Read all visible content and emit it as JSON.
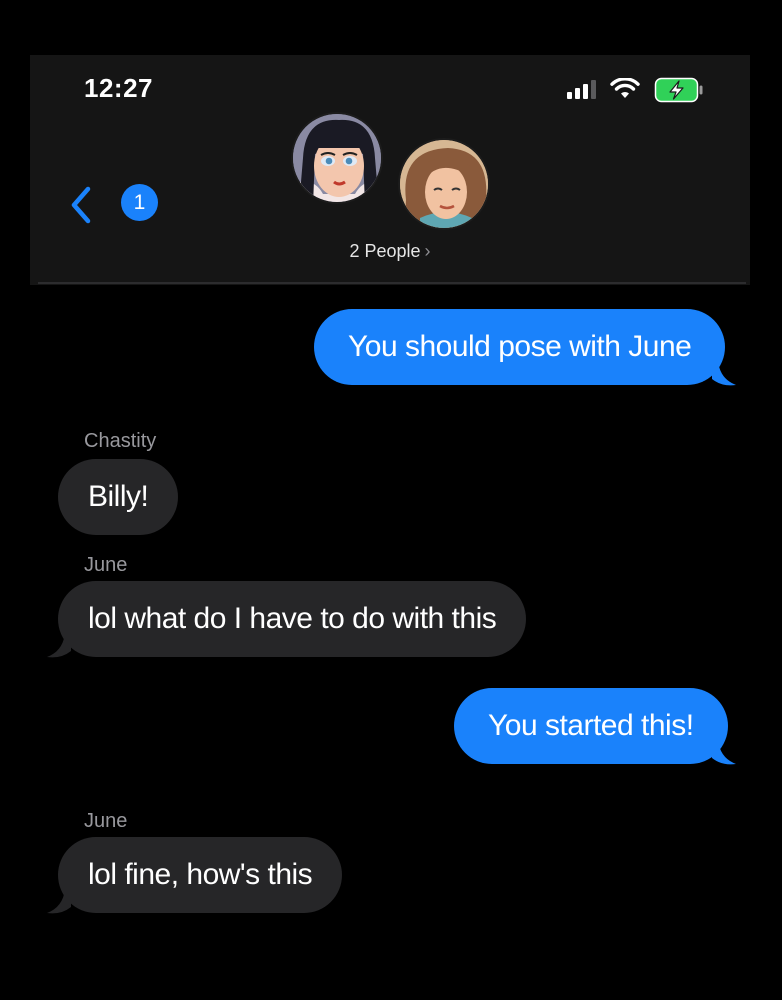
{
  "status_bar": {
    "time": "12:27",
    "signal_icon": "cellular-signal-icon",
    "wifi_icon": "wifi-icon",
    "battery_icon": "battery-charging-icon",
    "battery_color": "#30d158"
  },
  "header": {
    "back_icon": "chevron-left-icon",
    "unread_count": "1",
    "group_label": "2 People",
    "group_chevron": "›",
    "accent_color": "#1a82fb"
  },
  "messages": [
    {
      "direction": "outgoing",
      "sender": "",
      "text": "You should pose with June"
    },
    {
      "direction": "incoming",
      "sender": "Chastity",
      "text": "Billy!"
    },
    {
      "direction": "incoming",
      "sender": "June",
      "text": "lol what do I have to do with this"
    },
    {
      "direction": "outgoing",
      "sender": "",
      "text": "You started this!"
    },
    {
      "direction": "incoming",
      "sender": "June",
      "text": "lol fine, how's this"
    }
  ],
  "colors": {
    "outgoing_bubble": "#1a82fb",
    "incoming_bubble": "#262628",
    "background": "#000000"
  }
}
